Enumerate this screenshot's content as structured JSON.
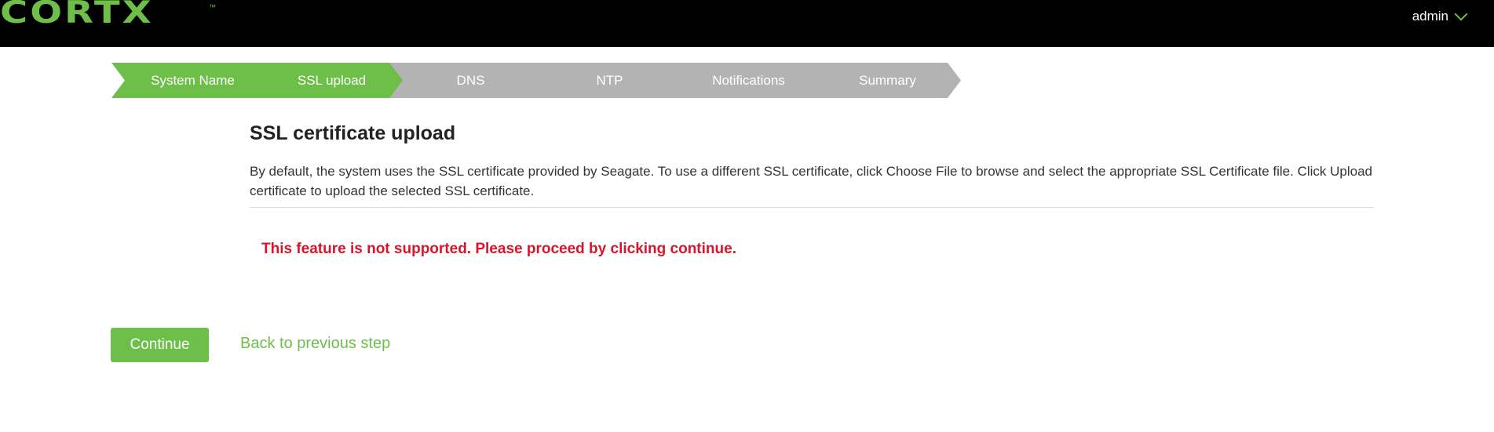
{
  "header": {
    "logo_text": "CORTX",
    "logo_tm": "™",
    "user_name": "admin",
    "user_menu_icon": "chevron-down-icon",
    "colors": {
      "background": "#000000",
      "accent": "#6ebe4a"
    }
  },
  "wizard": {
    "steps": [
      {
        "label": "System Name",
        "state": "complete"
      },
      {
        "label": "SSL upload",
        "state": "active"
      },
      {
        "label": "DNS",
        "state": "pending"
      },
      {
        "label": "NTP",
        "state": "pending"
      },
      {
        "label": "Notifications",
        "state": "pending"
      },
      {
        "label": "Summary",
        "state": "pending"
      }
    ],
    "colors": {
      "active": "#6ebe4a",
      "inactive": "#b3b3b3"
    }
  },
  "main": {
    "title": "SSL certificate upload",
    "description": "By default, the system uses the SSL certificate provided by Seagate. To use a different SSL certificate, click Choose File to browse and select the appropriate SSL Certificate file. Click Upload certificate to upload the selected SSL certificate.",
    "error_message": "This feature is not supported. Please proceed by clicking continue.",
    "error_color": "#d8152b"
  },
  "actions": {
    "continue_label": "Continue",
    "back_label": "Back to previous step"
  }
}
